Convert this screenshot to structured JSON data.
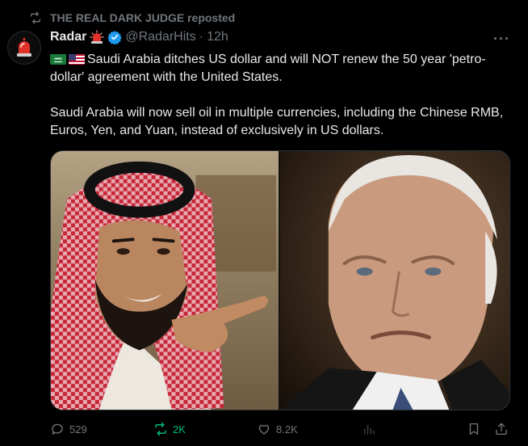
{
  "repost": {
    "text": "THE REAL DARK JUDGE reposted"
  },
  "post": {
    "author_name": "Radar",
    "handle": "@RadarHits",
    "separator": "·",
    "time": "12h",
    "more_label": "···",
    "line1": "Saudi Arabia ditches US dollar and will NOT renew the 50 year 'petro-dollar' agreement with the United States.",
    "line2": "Saudi Arabia will now sell oil in multiple currencies, including the Chinese RMB, Euros, Yen, and Yuan, instead of exclusively in US dollars."
  },
  "actions": {
    "replies": "529",
    "reposts": "2K",
    "likes": "8.2K",
    "views": ""
  },
  "icons": {
    "repost": "repost-icon",
    "avatar": "siren-icon",
    "verified": "verified-badge-icon",
    "reply": "reply-icon",
    "like": "heart-icon",
    "views": "views-icon",
    "bookmark": "bookmark-icon",
    "share": "share-icon"
  },
  "colors": {
    "background": "#000000",
    "text": "#e7e9ea",
    "muted": "#71767b",
    "verified": "#1d9bf0",
    "repost_active": "#00ba7c"
  }
}
